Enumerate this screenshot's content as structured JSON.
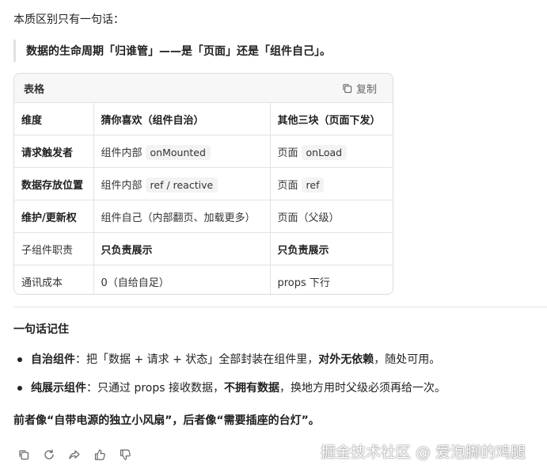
{
  "intro": "本质区别只有一句话：",
  "quote": "数据的生命周期「归谁管」——是「页面」还是「组件自己」。",
  "table_card": {
    "title": "表格",
    "copy_label": "复制",
    "headers": [
      "维度",
      "猜你喜欢（组件自治）",
      "其他三块（页面下发）"
    ],
    "rows": [
      {
        "dim": "请求触发者",
        "a_text": "组件内部",
        "a_code": "onMounted",
        "b_text": "页面",
        "b_code": "onLoad"
      },
      {
        "dim": "数据存放位置",
        "a_text": "组件内部",
        "a_code": "ref / reactive",
        "b_text": "页面",
        "b_code": "ref"
      },
      {
        "dim": "维护/更新权",
        "a_text": "组件自己（内部翻页、加载更多）",
        "b_text": "页面（父级）"
      },
      {
        "dim": "子组件职责",
        "a_text": "只负责展示",
        "b_text": "只负责展示"
      },
      {
        "dim": "通讯成本",
        "a_text": "0（自给自足）",
        "b_text": "props 下行"
      }
    ]
  },
  "remember_heading": "一句话记住",
  "points": [
    {
      "label": "自治组件",
      "text1": "：把「数据 + 请求 + 状态」全部封装在组件里，",
      "bold": "对外无依赖",
      "text2": "，随处可用。"
    },
    {
      "label": "纯展示组件",
      "text1": "：只通过 props 接收数据，",
      "bold": "不拥有数据",
      "text2": "，换地方用时父级必须再给一次。"
    }
  ],
  "summary": "前者像“自带电源的独立小风扇”，后者像“需要插座的台灯”。",
  "actions": [
    "copy-icon",
    "refresh-icon",
    "share-icon",
    "thumbs-up-icon",
    "thumbs-down-icon"
  ],
  "watermark": "掘金技术社区 @ 爱泡脚的鸡腿"
}
